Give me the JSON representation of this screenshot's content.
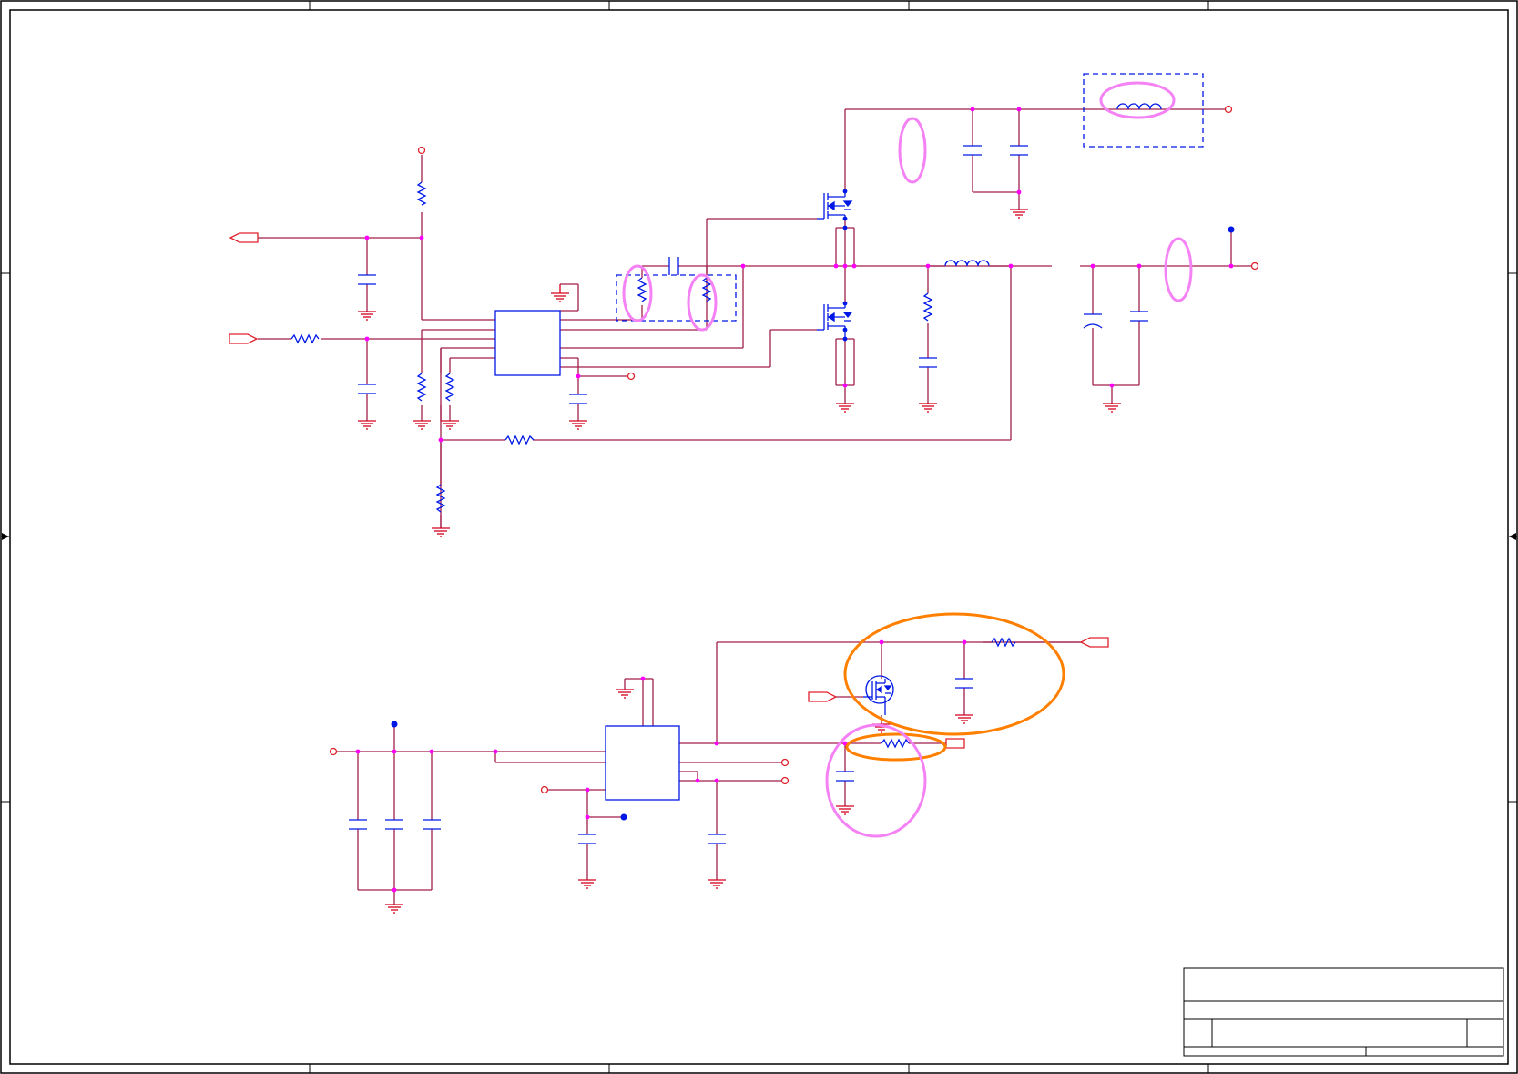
{
  "colors": {
    "wire": "#a01f4b",
    "component": "#0018e6",
    "ground": "#d4001e",
    "port": "#e0202a",
    "junction": "#ff00ff",
    "pink_highlight": "#f582f5",
    "orange_highlight": "#ff8000",
    "frame": "#000000"
  },
  "title_block": {
    "title": "",
    "subtitle": "",
    "sheet": "",
    "rev": ""
  }
}
